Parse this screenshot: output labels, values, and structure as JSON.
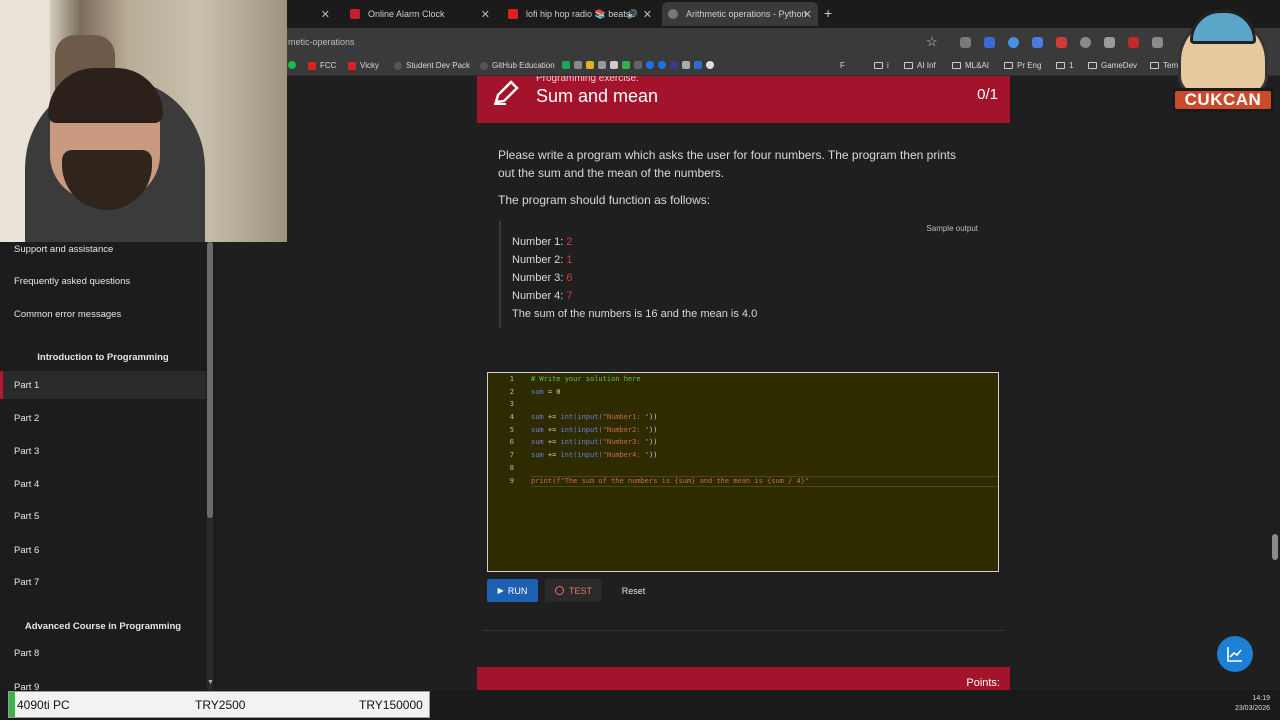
{
  "browser": {
    "tabs": [
      {
        "title": "",
        "close": "✕"
      },
      {
        "title": "Online Alarm Clock",
        "close": "✕"
      },
      {
        "title": "lofi hip hop radio 📚 beats",
        "close": "✕"
      },
      {
        "title": "Arithmetic operations - Python",
        "close": "✕"
      }
    ],
    "new_tab": "+",
    "url": "metic-operations",
    "star": "☆",
    "bookmarks": [
      "FCC",
      "Vicky",
      "Student Dev Pack",
      "GitHub Education",
      "F",
      "i",
      "AI Inf",
      "ML&AI",
      "Pr Eng",
      "1",
      "GameDev",
      "Tem"
    ]
  },
  "overlay": {
    "mascot_text": "CUKCAN"
  },
  "sidebar": {
    "items": [
      {
        "label": "Support and assistance"
      },
      {
        "label": "Frequently asked questions"
      },
      {
        "label": "Common error messages"
      }
    ],
    "section1": "Introduction to Programming",
    "parts": [
      "Part 1",
      "Part 2",
      "Part 3",
      "Part 4",
      "Part 5",
      "Part 6",
      "Part 7"
    ],
    "section2": "Advanced Course in Programming",
    "parts2": [
      "Part 8",
      "Part 9"
    ],
    "active_part": "Part 1"
  },
  "exercise": {
    "subtitle": "Programming exercise:",
    "title": "Sum and mean",
    "score": "0/1",
    "description": "Please write a program which asks the user for four numbers. The program then prints out the sum and the mean of the numbers.",
    "function_text": "The program should function as follows:",
    "sample_label": "Sample output",
    "sample": [
      {
        "prompt": "Number 1: ",
        "input": "2"
      },
      {
        "prompt": "Number 2: ",
        "input": "1"
      },
      {
        "prompt": "Number 3: ",
        "input": "6"
      },
      {
        "prompt": "Number 4: ",
        "input": "7"
      },
      {
        "prompt": "The sum of the numbers is 16 and the mean is 4.0",
        "input": ""
      }
    ]
  },
  "editor": {
    "line_numbers": [
      "1",
      "2",
      "3",
      "4",
      "5",
      "6",
      "7",
      "8",
      "9"
    ],
    "lines": {
      "l1": "# Write your solution here",
      "l2_var": "sum",
      "l2_rest": " = 0",
      "l4_var": "sum",
      "l4_op": " += ",
      "l4_fn": "int(input(",
      "l4_str": "\"Number1: \"",
      "l4_end": "))",
      "l5_str": "\"Number2: \"",
      "l6_str": "\"Number3: \"",
      "l7_str": "\"Number4: \"",
      "l9_fn": "print",
      "l9_str": "(f\"The sum of the numbers is {sum} and the mean is {sum / 4}\""
    }
  },
  "buttons": {
    "run": "RUN",
    "test": "TEST",
    "reset": "Reset"
  },
  "next_exercise": {
    "points": "Points:"
  },
  "ticker": {
    "name": "4090ti PC",
    "price1": "TRY2500",
    "price2": "TRY150000"
  },
  "clock": {
    "time": "14:19",
    "date": "23/03/2026"
  },
  "colors": {
    "accent": "#a3132b",
    "run": "#1d5fb0",
    "fab": "#1e7fd6"
  }
}
